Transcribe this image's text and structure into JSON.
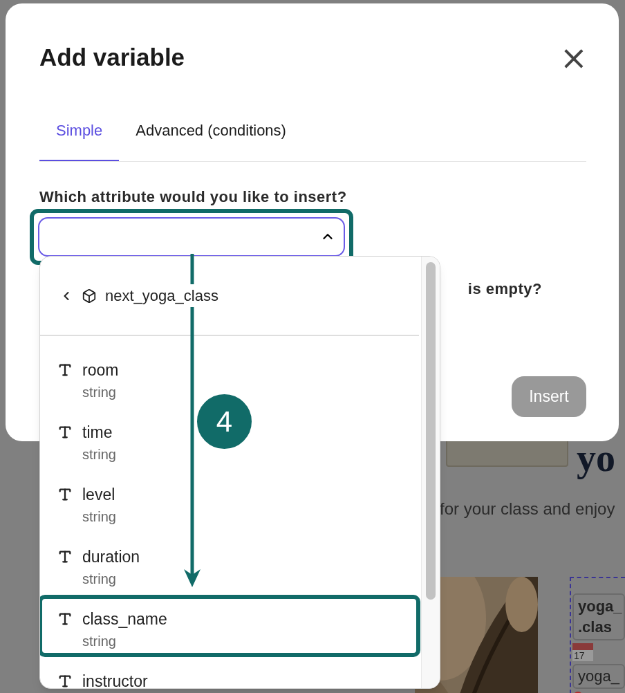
{
  "dialog": {
    "title": "Add variable",
    "close": "×"
  },
  "tabs": [
    {
      "label": "Simple",
      "selected": true
    },
    {
      "label": "Advanced (conditions)",
      "selected": false
    }
  ],
  "question": "Which attribute would you like to insert?",
  "select": {
    "open": true,
    "highlighted": true
  },
  "second_question": "is empty?",
  "insert_button": {
    "label": "Insert",
    "disabled": true
  },
  "dropdown": {
    "parent": "next_yoga_class",
    "items": [
      {
        "name": "room",
        "type": "string",
        "highlighted": false
      },
      {
        "name": "time",
        "type": "string",
        "highlighted": false
      },
      {
        "name": "level",
        "type": "string",
        "highlighted": false
      },
      {
        "name": "duration",
        "type": "string",
        "highlighted": false
      },
      {
        "name": "class_name",
        "type": "string",
        "highlighted": true
      },
      {
        "name": "instructor",
        "highlighted": false
      }
    ]
  },
  "step_badge": "4",
  "background": {
    "heading": "yo",
    "text": "for your class and enjoy",
    "chip_1": "yoga_",
    "chip_2": ".clas",
    "date": "17",
    "chip_3": "yoga_"
  }
}
